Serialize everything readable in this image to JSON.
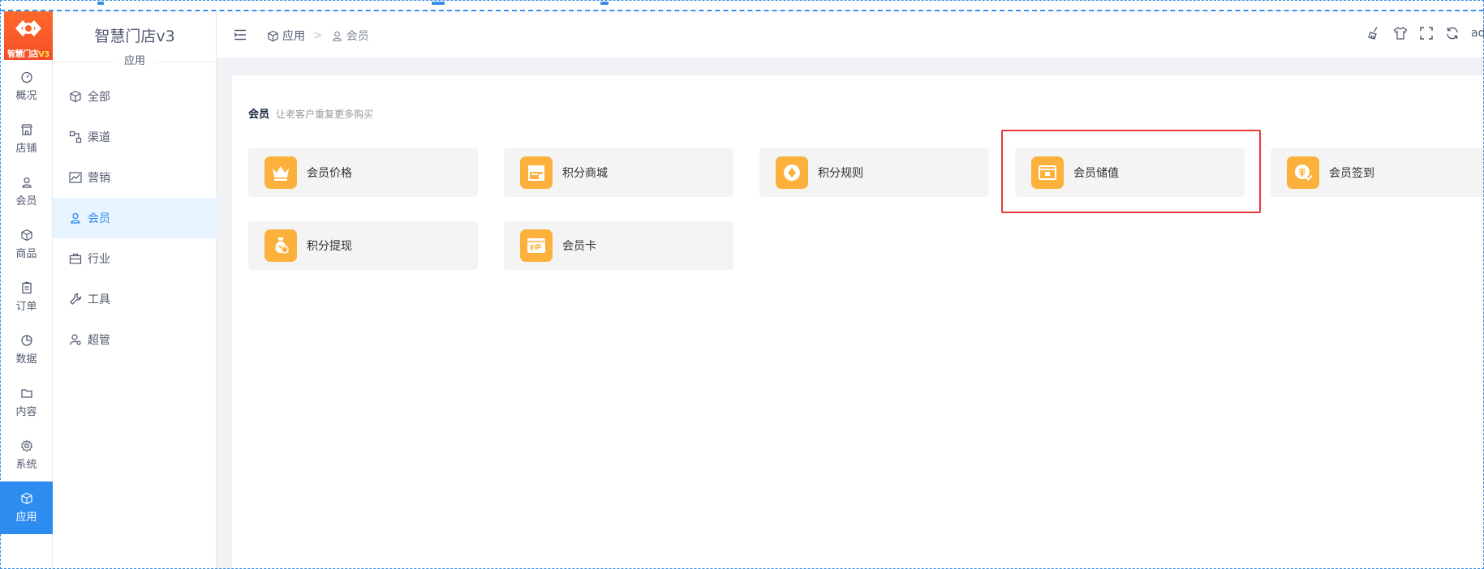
{
  "brand": {
    "logo_text": "智慧门店",
    "logo_version": "V3",
    "title": "智慧门店v3"
  },
  "rail": {
    "items": [
      {
        "label": "概况",
        "icon": "dashboard-icon"
      },
      {
        "label": "店铺",
        "icon": "store-icon"
      },
      {
        "label": "会员",
        "icon": "user-icon"
      },
      {
        "label": "商品",
        "icon": "box-icon"
      },
      {
        "label": "订单",
        "icon": "clipboard-icon"
      },
      {
        "label": "数据",
        "icon": "pie-chart-icon"
      },
      {
        "label": "内容",
        "icon": "folder-icon"
      },
      {
        "label": "系统",
        "icon": "gear-icon"
      },
      {
        "label": "应用",
        "icon": "box-icon",
        "active": true
      }
    ]
  },
  "sidebar": {
    "section": "应用",
    "items": [
      {
        "label": "全部",
        "icon": "cube-icon"
      },
      {
        "label": "渠道",
        "icon": "channel-icon"
      },
      {
        "label": "营销",
        "icon": "trend-chart-icon"
      },
      {
        "label": "会员",
        "icon": "user-icon",
        "active": true
      },
      {
        "label": "行业",
        "icon": "briefcase-icon"
      },
      {
        "label": "工具",
        "icon": "wrench-icon"
      },
      {
        "label": "超管",
        "icon": "admin-icon"
      }
    ]
  },
  "header": {
    "breadcrumb": [
      {
        "label": "应用",
        "icon": "cube-icon"
      },
      {
        "label": "会员",
        "icon": "user-icon"
      }
    ],
    "breadcrumb_separator": ">",
    "tools": [
      "broom-icon",
      "shirt-icon",
      "fullscreen-icon",
      "refresh-icon"
    ],
    "user": "ad"
  },
  "main": {
    "group_title": "会员",
    "group_subtitle": "让老客户重复更多购买",
    "apps": [
      {
        "label": "会员价格",
        "icon": "crown-icon"
      },
      {
        "label": "积分商城",
        "icon": "shop-icon"
      },
      {
        "label": "积分规则",
        "icon": "diamond-icon"
      },
      {
        "label": "会员储值",
        "icon": "card-icon",
        "highlighted": true
      },
      {
        "label": "会员签到",
        "icon": "sign-in-icon"
      },
      {
        "label": "积分提现",
        "icon": "money-bag-icon"
      },
      {
        "label": "会员卡",
        "icon": "vip-card-icon"
      }
    ]
  },
  "colors": {
    "accent": "#2d8cf0",
    "active_bg": "#e8f4ff",
    "tile_bg": "#f4f4f5",
    "app_icon_bg": "#fbb13c",
    "highlight": "#e53935",
    "logo": "#f34d2a"
  }
}
